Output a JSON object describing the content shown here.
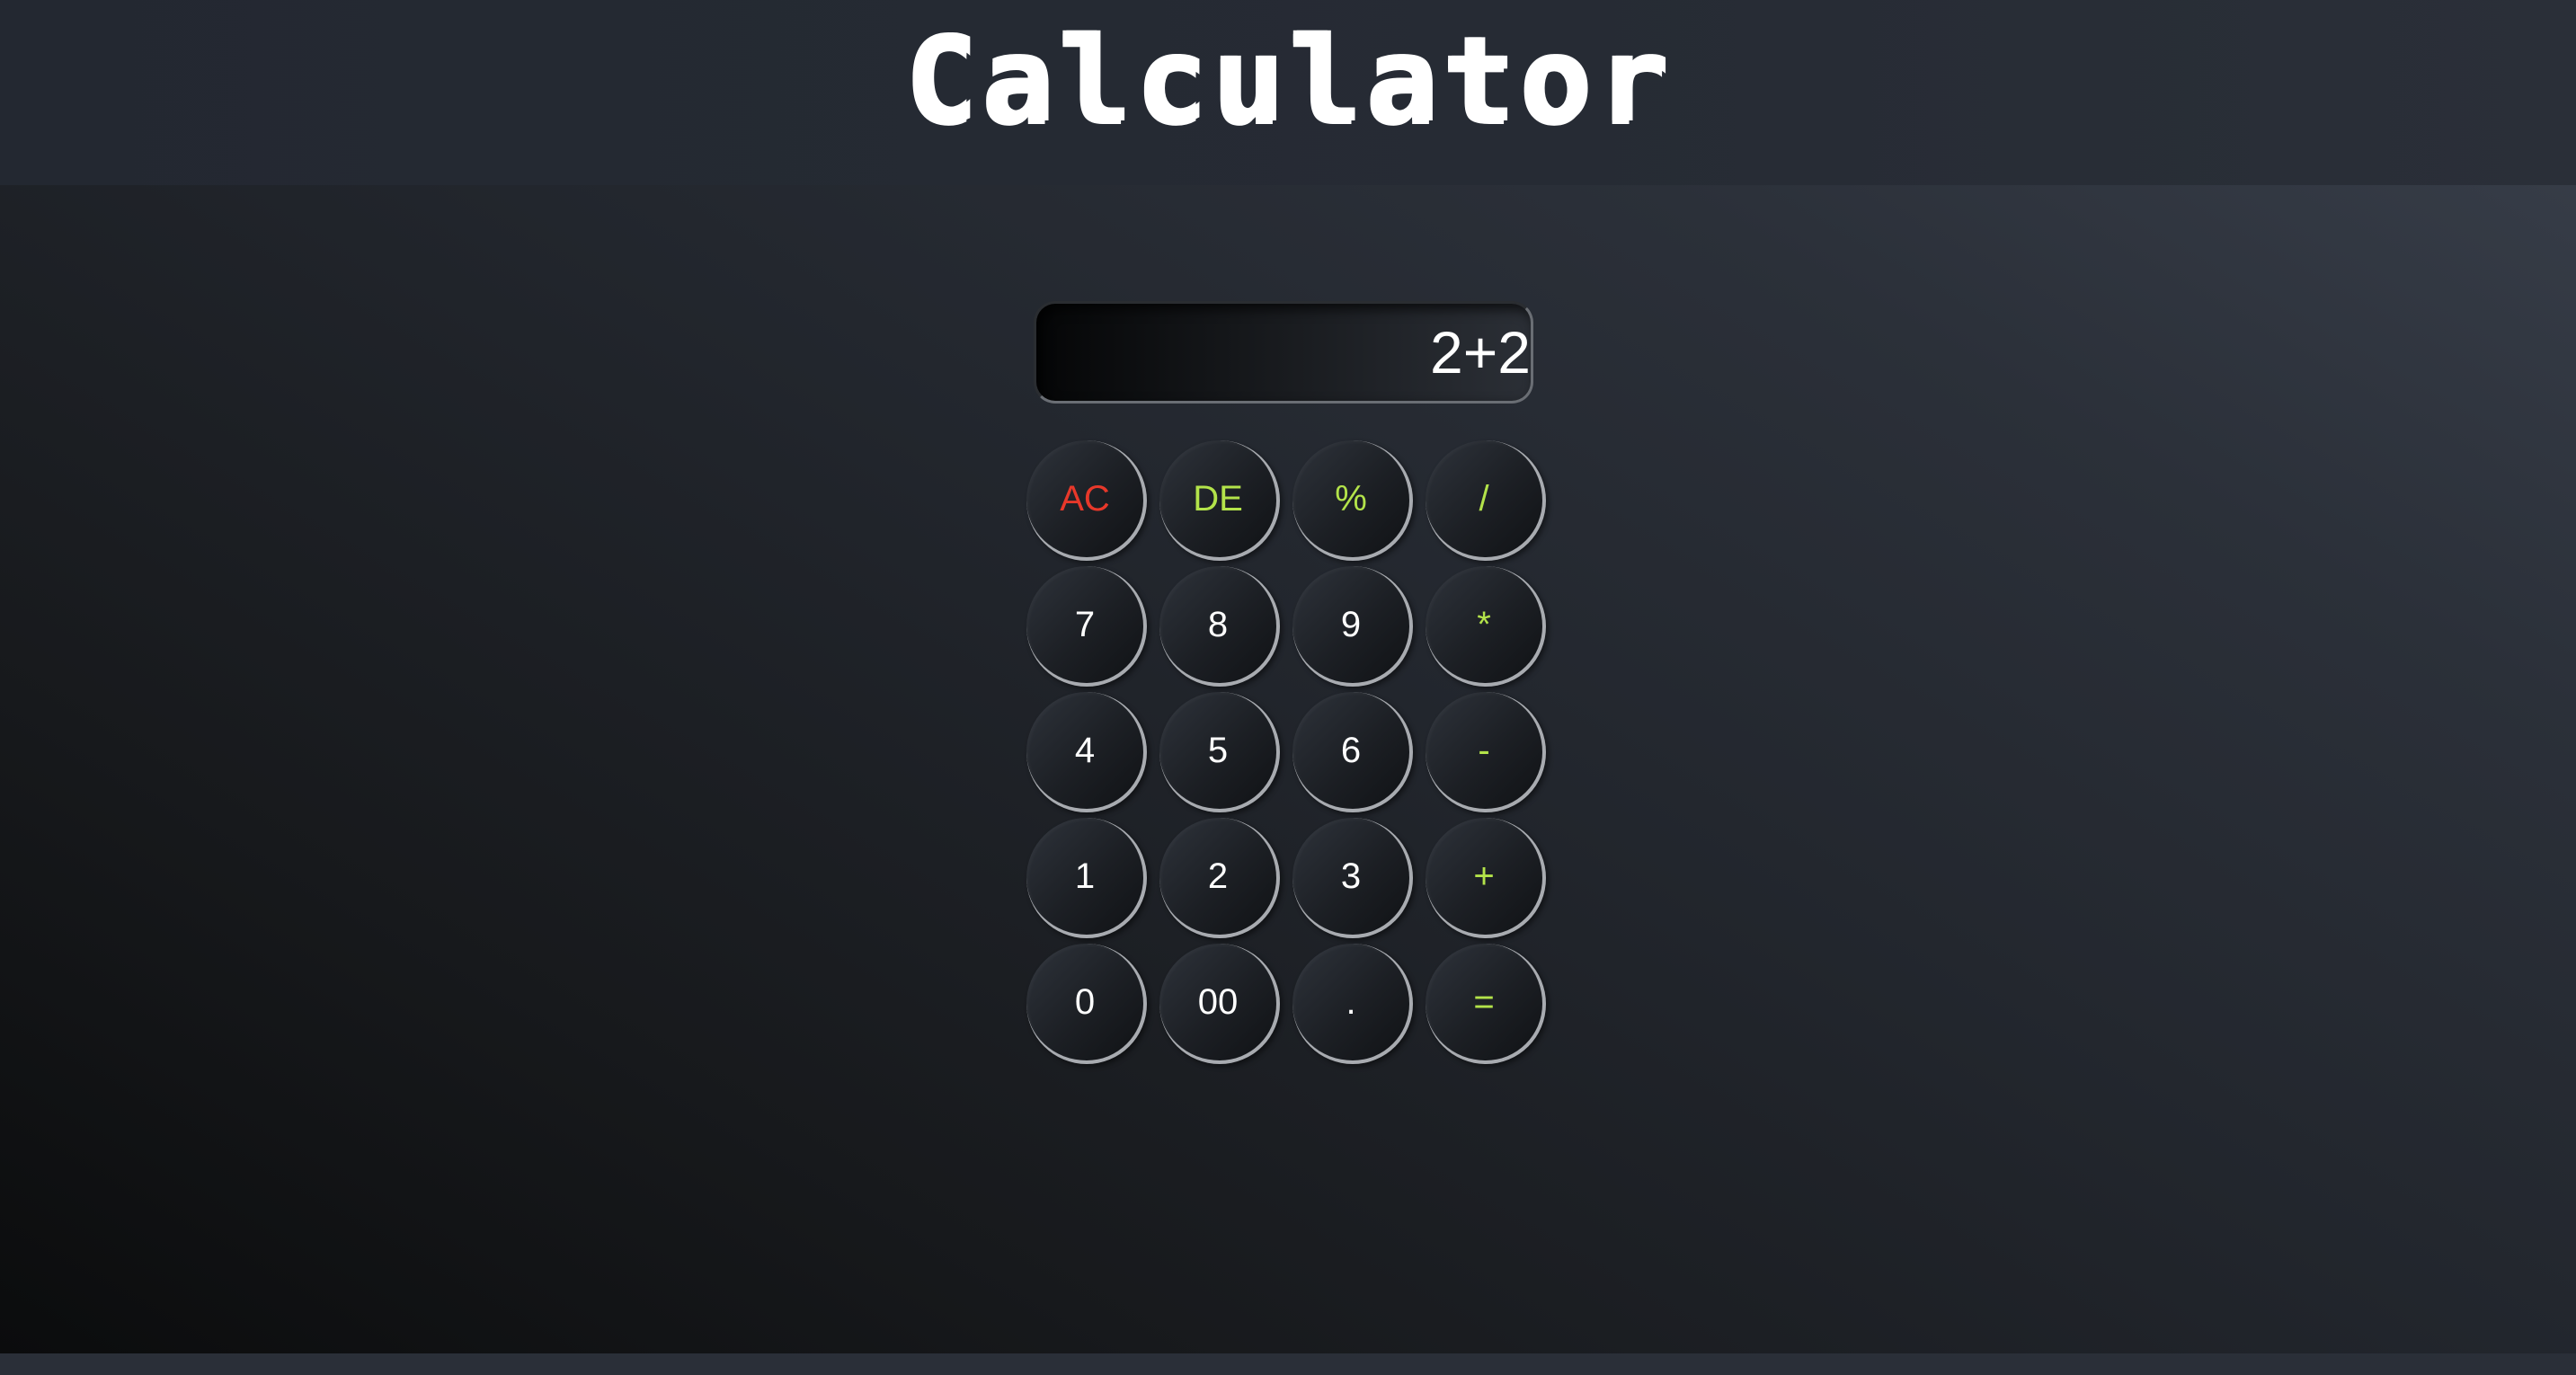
{
  "header": {
    "title": "Calculator"
  },
  "display": {
    "value": "2+2"
  },
  "colors": {
    "clear": "#e8382a",
    "operator": "#b3e34a",
    "digit": "#ffffff"
  },
  "keys": [
    {
      "label": "AC",
      "role": "clear"
    },
    {
      "label": "DE",
      "role": "operator"
    },
    {
      "label": "%",
      "role": "operator"
    },
    {
      "label": "/",
      "role": "operator"
    },
    {
      "label": "7",
      "role": "digit"
    },
    {
      "label": "8",
      "role": "digit"
    },
    {
      "label": "9",
      "role": "digit"
    },
    {
      "label": "*",
      "role": "operator"
    },
    {
      "label": "4",
      "role": "digit"
    },
    {
      "label": "5",
      "role": "digit"
    },
    {
      "label": "6",
      "role": "digit"
    },
    {
      "label": "-",
      "role": "operator"
    },
    {
      "label": "1",
      "role": "digit"
    },
    {
      "label": "2",
      "role": "digit"
    },
    {
      "label": "3",
      "role": "digit"
    },
    {
      "label": "+",
      "role": "operator"
    },
    {
      "label": "0",
      "role": "digit"
    },
    {
      "label": "00",
      "role": "digit"
    },
    {
      "label": ".",
      "role": "digit"
    },
    {
      "label": "=",
      "role": "operator"
    }
  ]
}
